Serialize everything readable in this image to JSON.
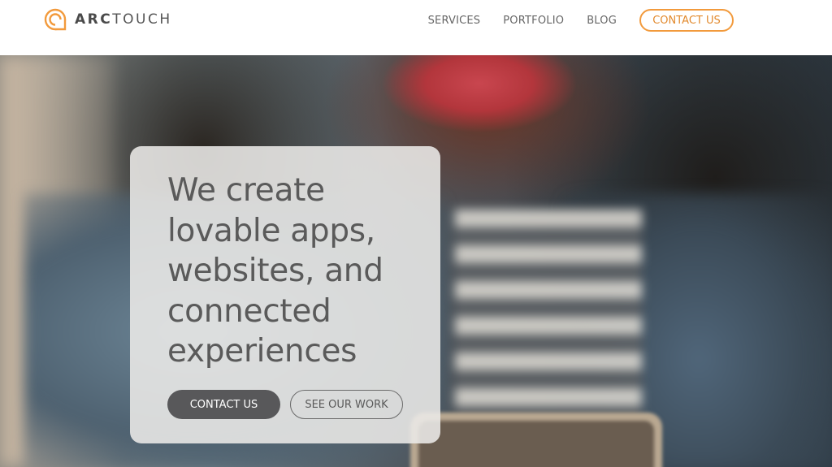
{
  "header": {
    "logo": {
      "text_bold": "ARC",
      "text_light": "TOUCH",
      "icon": "arctouch-logo-icon"
    },
    "nav": [
      {
        "label": "SERVICES"
      },
      {
        "label": "PORTFOLIO"
      },
      {
        "label": "BLOG"
      }
    ],
    "cta_label": "CONTACT US"
  },
  "hero": {
    "headline": "We create lovable apps, websites, and connected experiences",
    "primary_button": "CONTACT US",
    "secondary_button": "SEE OUR WORK"
  },
  "colors": {
    "accent": "#f29a3c",
    "primary_button_bg": "#58585a",
    "headline_text": "#5a5a5a"
  }
}
